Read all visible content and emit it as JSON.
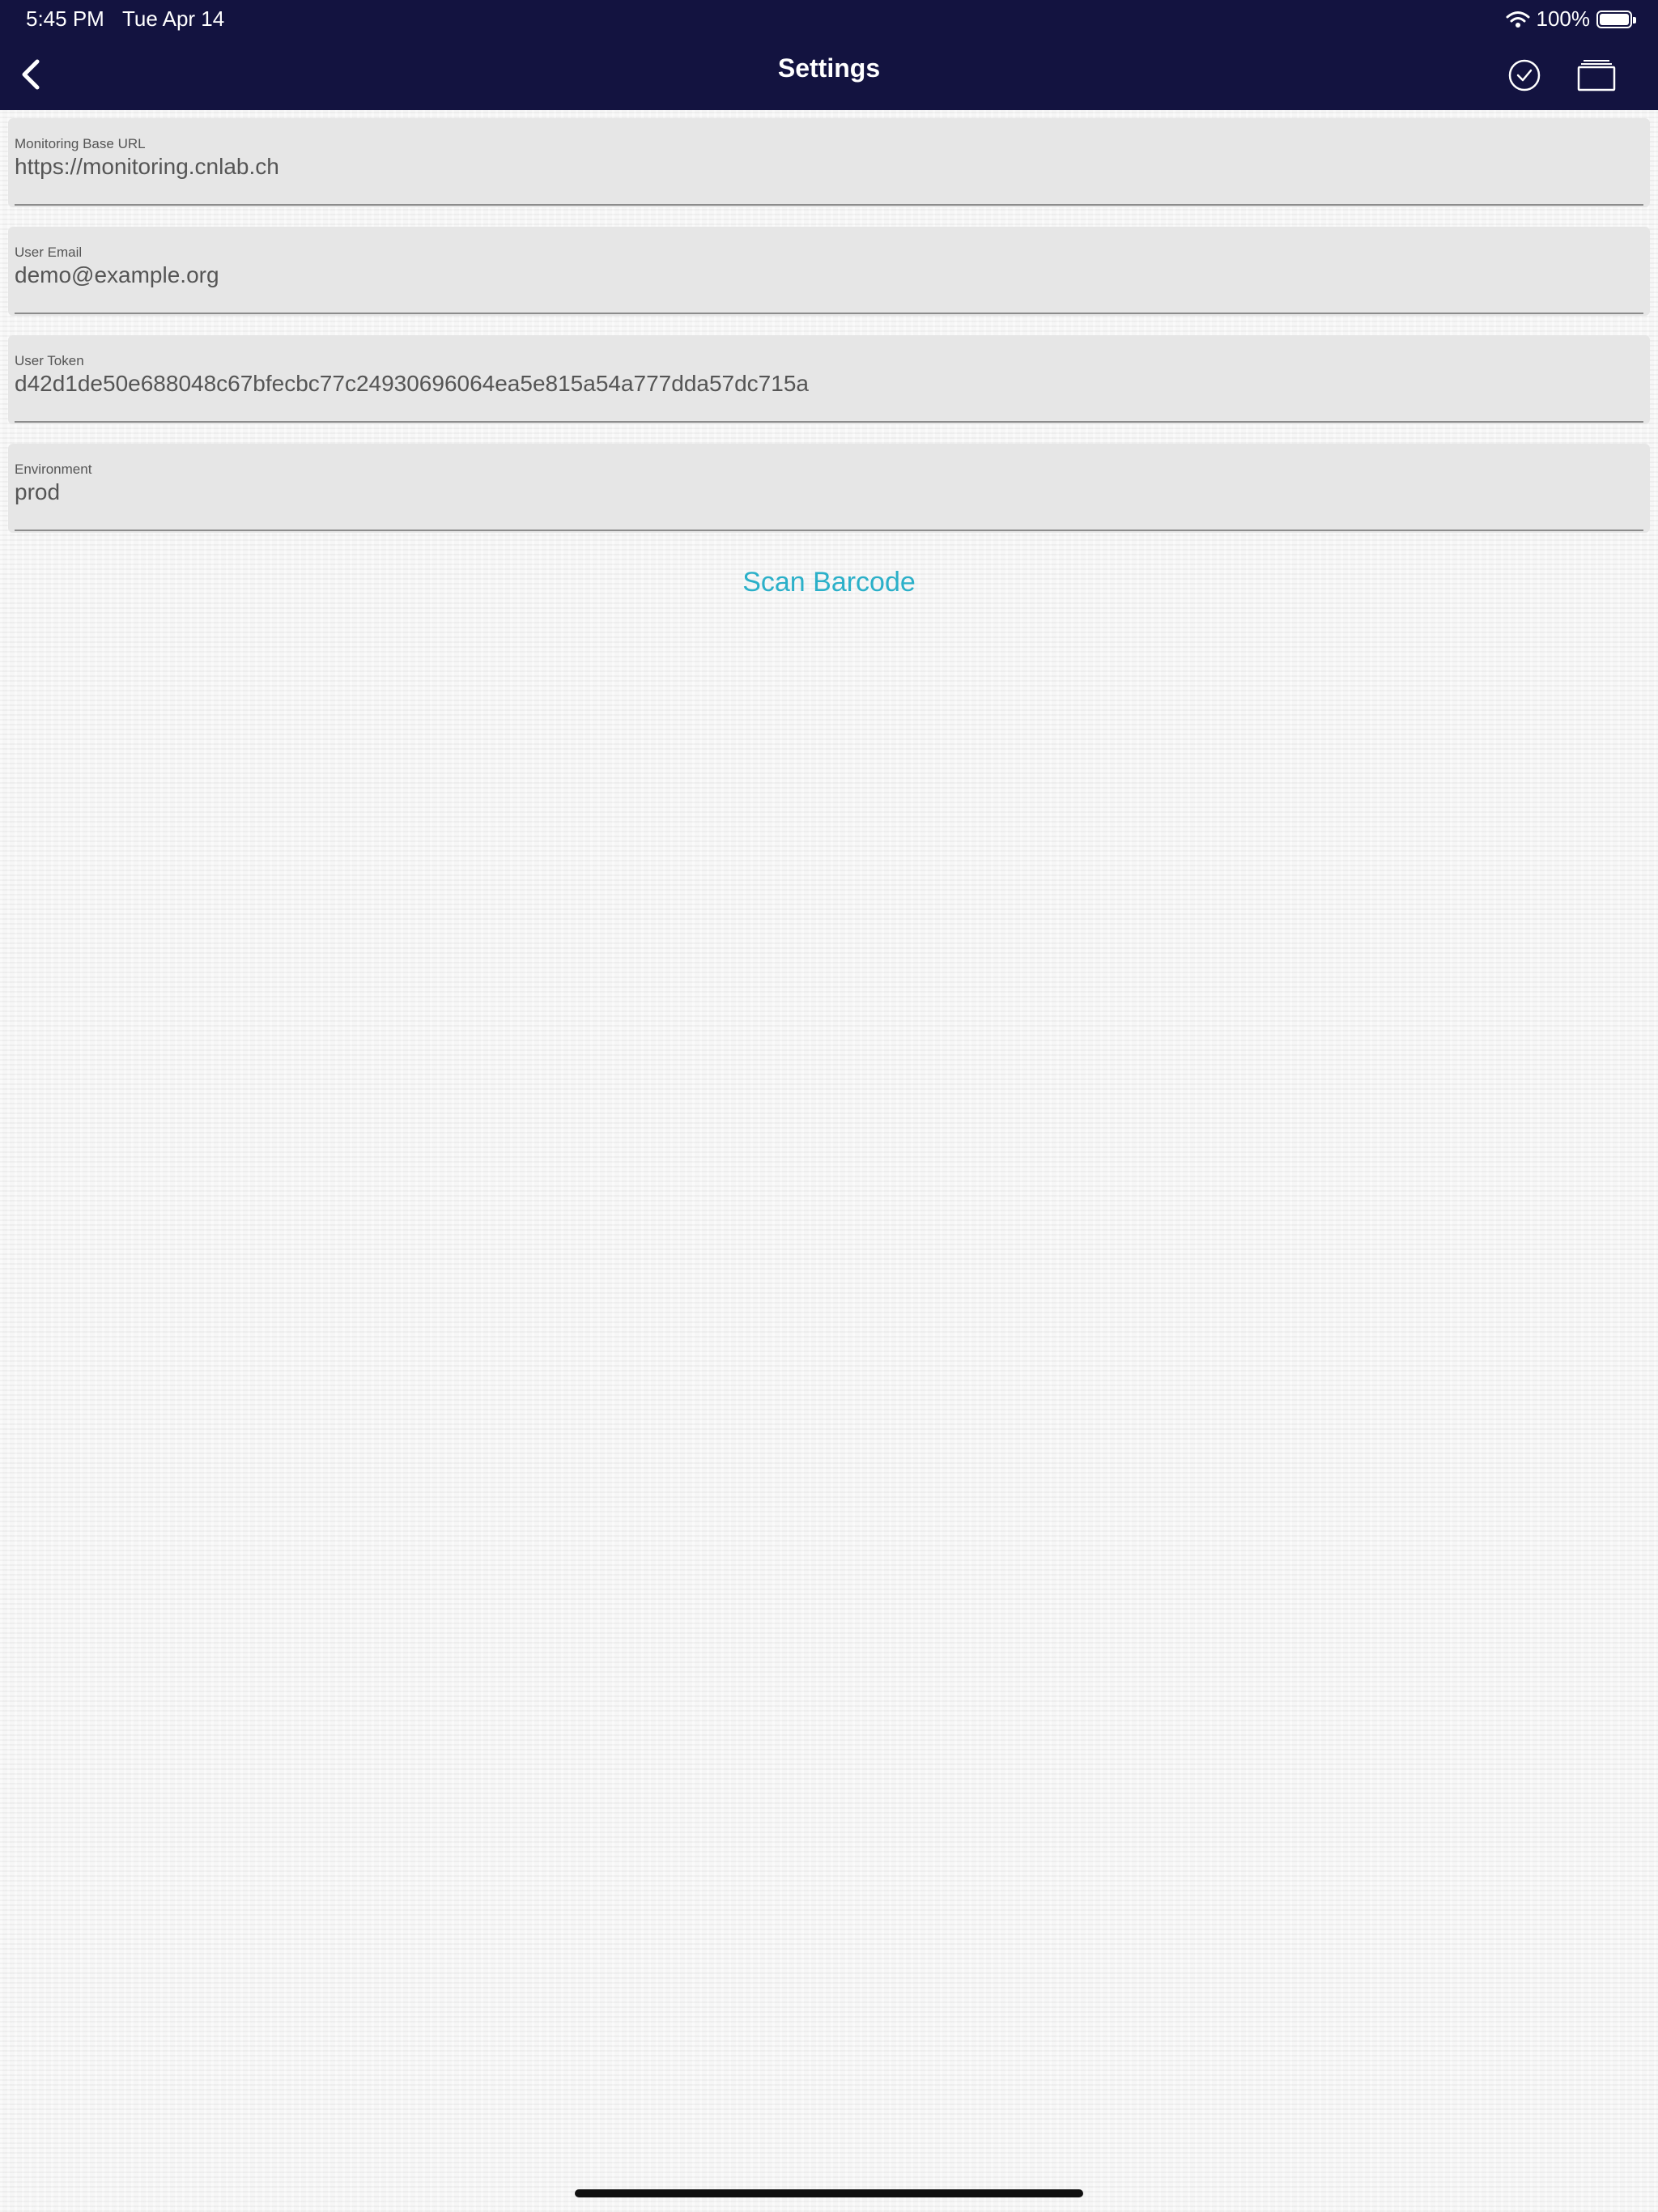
{
  "status_bar": {
    "time": "5:45 PM",
    "date": "Tue Apr 14",
    "battery_percent": "100%",
    "battery_level": 1.0
  },
  "nav": {
    "title": "Settings",
    "back_icon": "chevron-left-icon",
    "confirm_icon": "checkmark-circle-icon",
    "cards_icon": "stacked-cards-icon"
  },
  "fields": [
    {
      "label": "Monitoring Base URL",
      "value": "https://monitoring.cnlab.ch"
    },
    {
      "label": "User Email",
      "value": "demo@example.org"
    },
    {
      "label": "User Token",
      "value": "d42d1de50e688048c67bfecbc77c24930696064ea5e815a54a777dda57dc715a"
    },
    {
      "label": "Environment",
      "value": "prod"
    }
  ],
  "actions": {
    "scan_barcode": "Scan Barcode"
  },
  "colors": {
    "nav_background": "#131340",
    "accent": "#2bb0c9",
    "field_background": "#e6e6e6"
  }
}
